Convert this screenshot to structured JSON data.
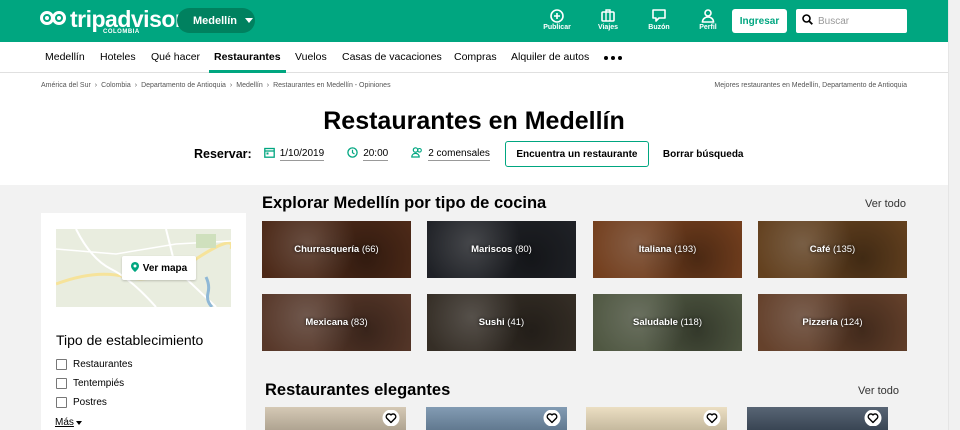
{
  "header": {
    "logo_text": "tripadvisor",
    "logo_country": "COLOMBIA",
    "city_selector": "Medellín",
    "actions": [
      {
        "label": "Publicar",
        "icon": "plus-circle-icon"
      },
      {
        "label": "Viajes",
        "icon": "suitcase-icon"
      },
      {
        "label": "Buzón",
        "icon": "message-icon"
      },
      {
        "label": "Perfil",
        "icon": "user-icon"
      }
    ],
    "login_label": "Ingresar",
    "search_placeholder": "Buscar"
  },
  "nav": {
    "items": [
      "Medellín",
      "Hoteles",
      "Qué hacer",
      "Restaurantes",
      "Vuelos",
      "Casas de vacaciones",
      "Compras",
      "Alquiler de autos"
    ],
    "active": "Restaurantes"
  },
  "breadcrumb": {
    "items": [
      "América del Sur",
      "Colombia",
      "Departamento de Antioquia",
      "Medellín",
      "Restaurantes en Medellín - Opiniones"
    ],
    "right_text": "Mejores restaurantes en Medellín, Departamento de Antioquia"
  },
  "page": {
    "title": "Restaurantes en Medellín"
  },
  "reservation": {
    "label": "Reservar:",
    "date": "1/10/2019",
    "time": "20:00",
    "guests": "2 comensales",
    "find_button": "Encuentra un restaurante",
    "clear_button": "Borrar búsqueda"
  },
  "sidebar": {
    "map_button": "Ver mapa",
    "filter_title": "Tipo de establecimiento",
    "options": [
      "Restaurantes",
      "Tentempiés",
      "Postres"
    ],
    "more_label": "Más"
  },
  "cuisine_section": {
    "title": "Explorar Medellín por tipo de cocina",
    "see_all": "Ver todo",
    "tiles": [
      {
        "name": "Churrasquería",
        "count": "(66)",
        "color": "#6b3a22"
      },
      {
        "name": "Mariscos",
        "count": "(80)",
        "color": "#2c2f36"
      },
      {
        "name": "Italiana",
        "count": "(193)",
        "color": "#a1582a"
      },
      {
        "name": "Café",
        "count": "(135)",
        "color": "#8a5a2b"
      },
      {
        "name": "Mexicana",
        "count": "(83)",
        "color": "#7a4e3a"
      },
      {
        "name": "Sushi",
        "count": "(41)",
        "color": "#4a4035"
      },
      {
        "name": "Saludable",
        "count": "(118)",
        "color": "#6f7a5c"
      },
      {
        "name": "Pizzería",
        "count": "(124)",
        "color": "#8c5a3c"
      }
    ]
  },
  "elegant_section": {
    "title": "Restaurantes elegantes",
    "see_all": "Ver todo",
    "cards": [
      {
        "color": "#cdbfa8"
      },
      {
        "color": "#6d8aa6"
      },
      {
        "color": "#e8d9b8"
      },
      {
        "color": "#3b4a5c"
      }
    ]
  }
}
